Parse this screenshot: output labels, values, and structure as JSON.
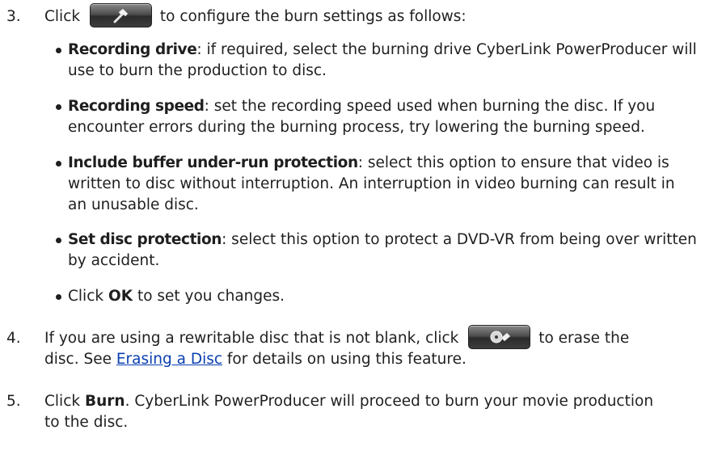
{
  "steps": [
    {
      "num": "3.",
      "before_icon": "Click",
      "icon": "settings-hammer-icon",
      "after_icon": "to configure the burn settings as follows:"
    },
    {
      "num": "4.",
      "line1_before_icon": "If you are using a rewritable disc that is not blank, click",
      "icon": "erase-disc-icon",
      "line1_after_icon": "to erase the",
      "line2_before_link": "disc. See",
      "link_text": "Erasing a Disc",
      "line2_after_link": "for details on using this feature."
    },
    {
      "num": "5.",
      "before_bold": "Click",
      "bold": "Burn",
      "after_bold": ". CyberLink PowerProducer will proceed to burn your movie production to the disc."
    }
  ],
  "bullets": [
    {
      "term": "Recording drive",
      "text": ": if required, select the burning drive CyberLink PowerProducer will use to burn the production to disc."
    },
    {
      "term": "Recording speed",
      "text": ": set the recording speed used when burning the disc. If you encounter errors during the burning process, try lowering the burning speed."
    },
    {
      "term": "Include buffer under-run protection",
      "text": ": select this option to ensure that video is written to disc without interruption. An interruption in video burning can result in an unusable disc."
    },
    {
      "term": "Set disc protection",
      "text": ": select this option to protect a DVD-VR from being over written by accident."
    },
    {
      "before_bold": "Click",
      "bold": "OK",
      "after_bold": "to set you changes."
    }
  ]
}
